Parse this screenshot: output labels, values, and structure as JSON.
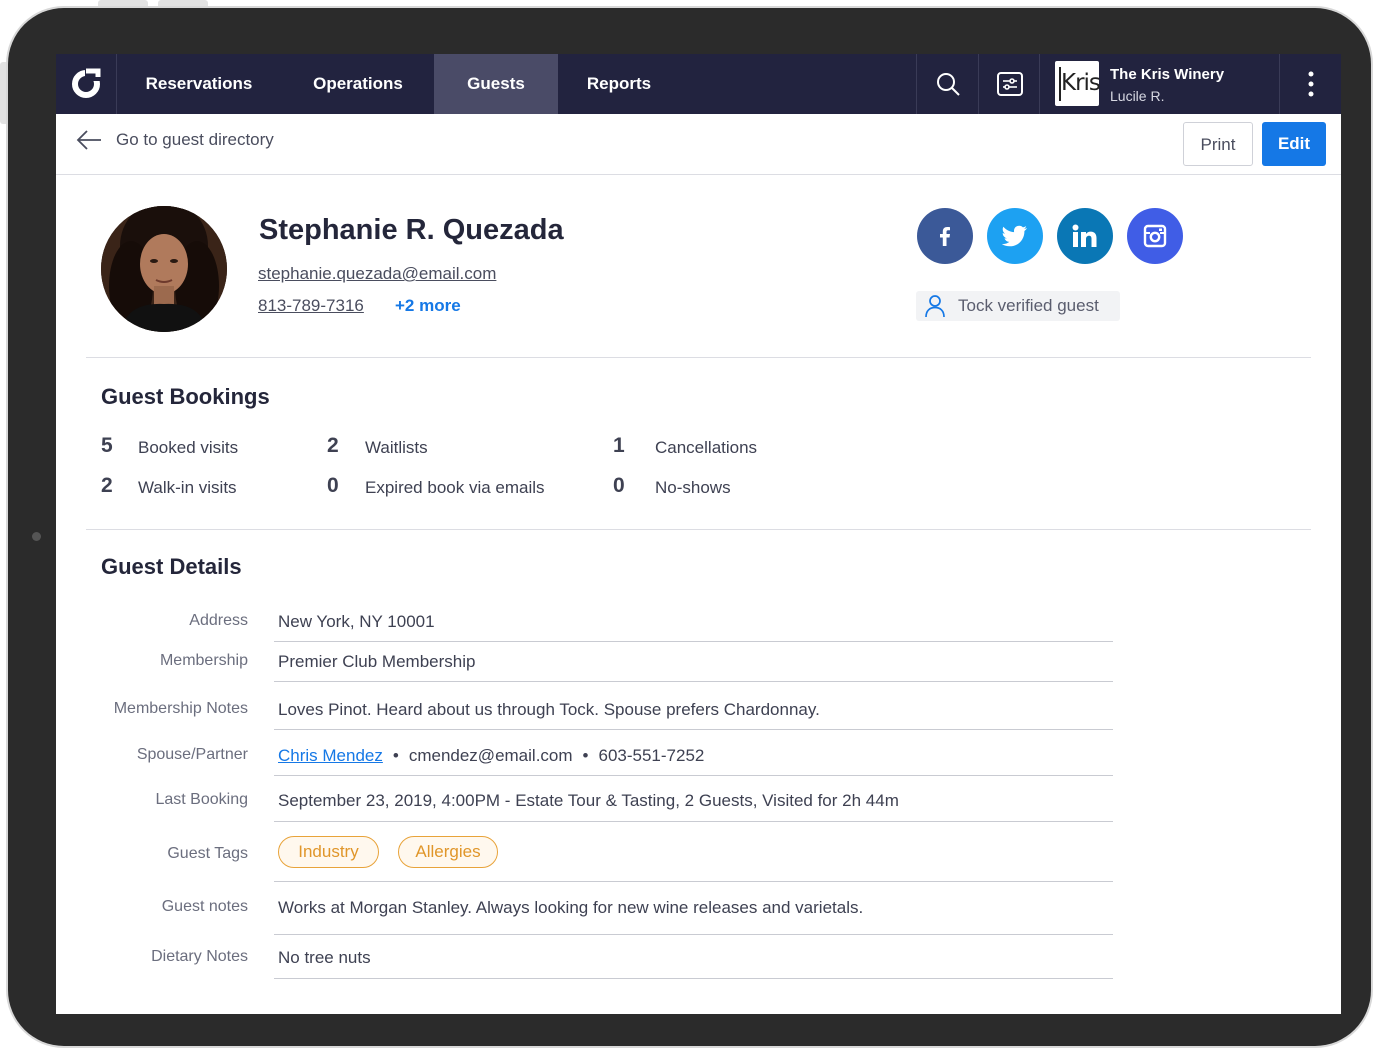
{
  "nav": {
    "tabs": [
      {
        "label": "Reservations"
      },
      {
        "label": "Operations"
      },
      {
        "label": "Guests"
      },
      {
        "label": "Reports"
      }
    ],
    "active_tab": "Guests",
    "account": {
      "logo_text": "Kris",
      "business_name": "The Kris Winery",
      "user_name": "Lucile R."
    },
    "icons": [
      "logo-icon",
      "search-icon",
      "filter-panel-icon",
      "more-vertical-icon"
    ]
  },
  "subbar": {
    "back_label": "Go to guest directory",
    "print_label": "Print",
    "edit_label": "Edit"
  },
  "guest": {
    "name": "Stephanie R. Quezada",
    "email": "stephanie.quezada@email.com",
    "phone": "813-789-7316",
    "more_contacts": "+2 more",
    "verified_label": "Tock verified guest",
    "social": [
      "facebook-icon",
      "twitter-icon",
      "linkedin-icon",
      "instagram-icon"
    ]
  },
  "bookings": {
    "title": "Guest Bookings",
    "stats": [
      {
        "value": "5",
        "label": "Booked visits"
      },
      {
        "value": "2",
        "label": "Waitlists"
      },
      {
        "value": "1",
        "label": "Cancellations"
      },
      {
        "value": "2",
        "label": "Walk-in visits"
      },
      {
        "value": "0",
        "label": "Expired book via emails"
      },
      {
        "value": "0",
        "label": "No-shows"
      }
    ]
  },
  "details": {
    "title": "Guest Details",
    "address": {
      "label": "Address",
      "value": "New York, NY 10001"
    },
    "membership": {
      "label": "Membership",
      "value": "Premier Club Membership"
    },
    "membership_notes": {
      "label": "Membership Notes",
      "value": "Loves Pinot. Heard about us through Tock. Spouse prefers Chardonnay."
    },
    "spouse": {
      "label": "Spouse/Partner",
      "name": "Chris Mendez",
      "separator": "•",
      "email": "cmendez@email.com",
      "phone": "603-551-7252"
    },
    "last_booking": {
      "label": "Last Booking",
      "value": "September 23, 2019, 4:00PM - Estate Tour & Tasting, 2 Guests, Visited for 2h 44m"
    },
    "guest_tags": {
      "label": "Guest Tags",
      "tags": [
        "Industry",
        "Allergies"
      ]
    },
    "guest_notes": {
      "label": "Guest notes",
      "value": "Works at Morgan Stanley. Always looking for new wine releases and varietals."
    },
    "dietary_notes": {
      "label": "Dietary Notes",
      "value": "No tree nuts"
    }
  },
  "colors": {
    "nav_bg": "#22233f",
    "nav_active": "#4a4b67",
    "primary": "#1578e6",
    "tag": "#e8a33a",
    "facebook": "#3b5998",
    "twitter": "#1da1f2",
    "linkedin": "#0a77b5",
    "instagram": "#405de6"
  }
}
